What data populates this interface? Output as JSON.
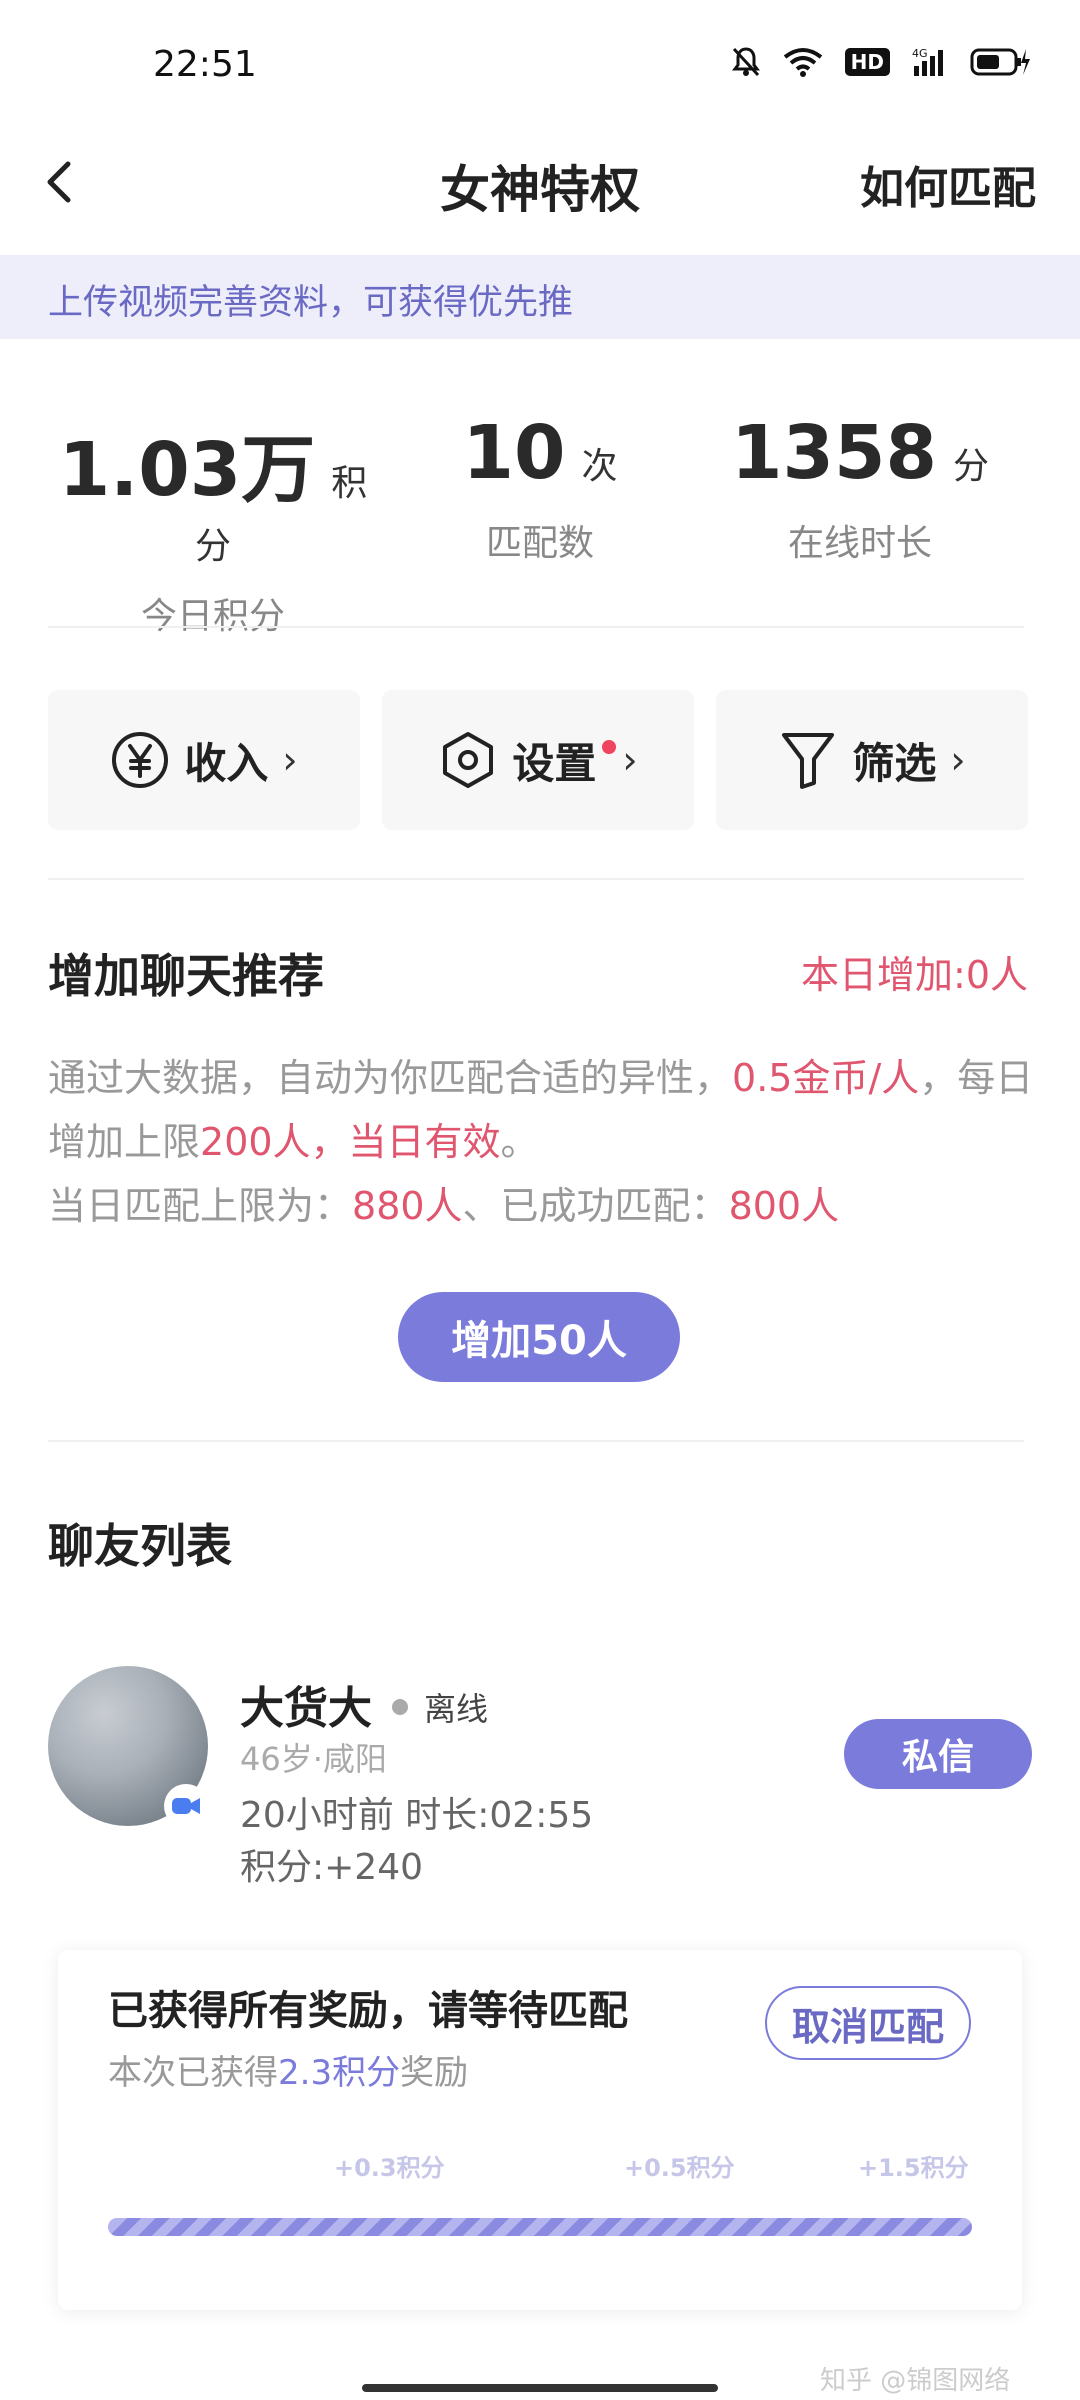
{
  "status_bar": {
    "time": "22:51",
    "hd": "HD",
    "network": "4G"
  },
  "header": {
    "title": "女神特权",
    "right_action": "如何匹配"
  },
  "banner": {
    "text": "上传视频完善资料，可获得优先推"
  },
  "stats": [
    {
      "value": "1.03万",
      "unit": "积分",
      "label": "今日积分"
    },
    {
      "value": "10",
      "unit": "次",
      "label": "匹配数"
    },
    {
      "value": "1358",
      "unit": "分",
      "label": "在线时长"
    }
  ],
  "quick_actions": [
    {
      "label": "收入",
      "icon": "yen-icon",
      "chevron": "›"
    },
    {
      "label": "设置",
      "icon": "hexagon-settings-icon",
      "chevron": "›",
      "badge": true
    },
    {
      "label": "筛选",
      "icon": "filter-icon",
      "chevron": "›"
    }
  ],
  "recommend": {
    "title": "增加聊天推荐",
    "today_added": "本日增加:0人",
    "desc_part1": "通过大数据，自动为你匹配合适的异性，",
    "desc_price": "0.5金币/人",
    "desc_part2": "，每日增加上限",
    "desc_limit": "200人，当日有效",
    "desc_part3": "。",
    "desc_line3_a": "当日匹配上限为：",
    "desc_max": "880人",
    "desc_line3_b": "、已成功匹配：",
    "desc_matched": "800人",
    "button": "增加50人"
  },
  "friends": {
    "title": "聊友列表",
    "items": [
      {
        "name": "大货大",
        "status": "离线",
        "meta": "46岁·咸阳",
        "time": "20小时前 时长:02:55",
        "points": "积分:+240",
        "action": "私信"
      }
    ]
  },
  "reward": {
    "title": "已获得所有奖励，请等待匹配",
    "sub_prefix": "本次已获得",
    "sub_points": "2.3积分",
    "sub_suffix": "奖励",
    "cancel": "取消匹配",
    "milestones": [
      "+0.3积分",
      "+0.5积分",
      "+1.5积分"
    ],
    "progress": 1.0
  },
  "watermark": "知乎 @锦图网络",
  "colors": {
    "accent": "#7b7bdc",
    "highlight": "#e0566f",
    "banner_bg": "#eeeefb"
  }
}
